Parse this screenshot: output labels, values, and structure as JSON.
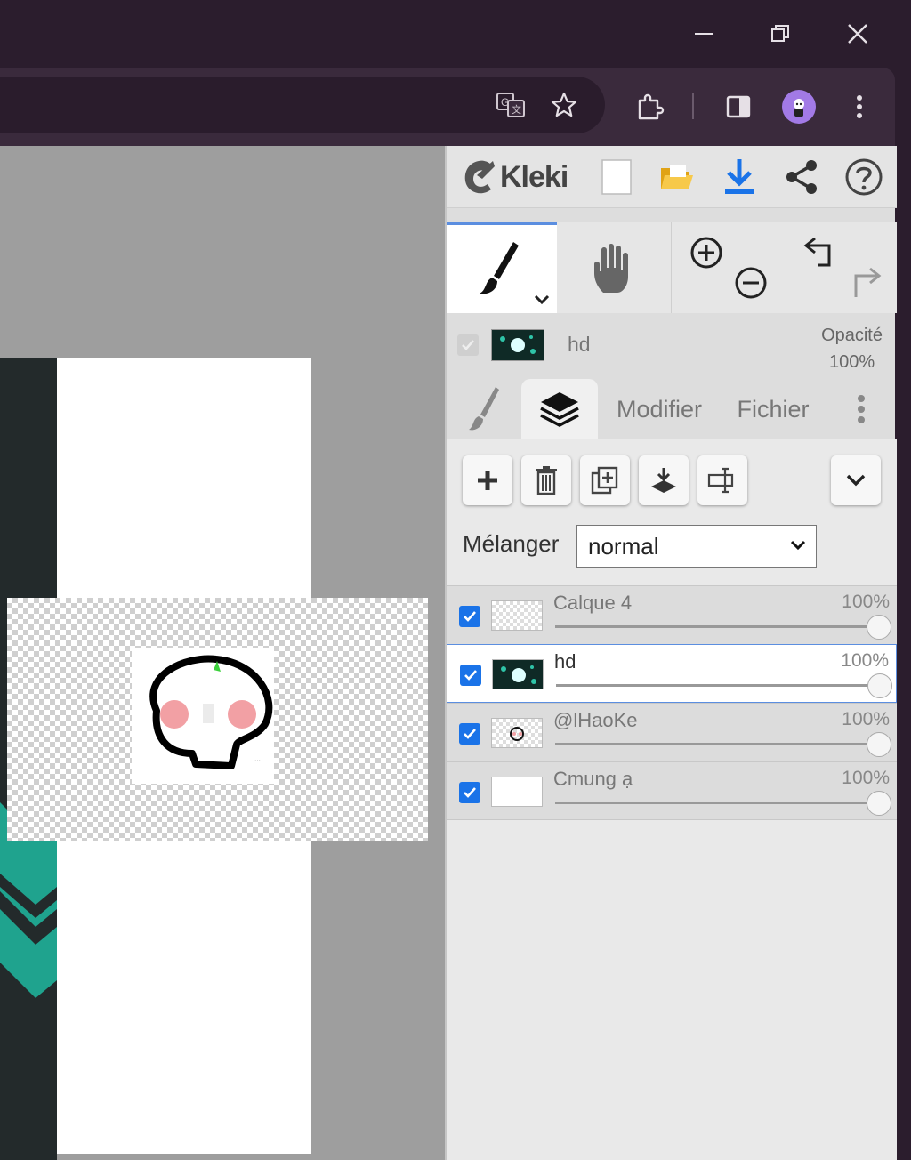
{
  "app": {
    "name": "Kleki"
  },
  "layer_info": {
    "current_name": "hd",
    "opacity_label": "Opacité",
    "opacity_value": "100%"
  },
  "tabs": {
    "modifier": "Modifier",
    "fichier": "Fichier"
  },
  "blend": {
    "label": "Mélanger",
    "value": "normal"
  },
  "layers": [
    {
      "name": "Calque 4",
      "opacity": "100%",
      "selected": false
    },
    {
      "name": "hd",
      "opacity": "100%",
      "selected": true
    },
    {
      "name": "@lHaoKe",
      "opacity": "100%",
      "selected": false
    },
    {
      "name": "Cmung ạ",
      "opacity": "100%",
      "selected": false
    }
  ],
  "colors": {
    "accent": "#1a73e8",
    "download": "#1a73e8",
    "folder": "#f2b51f",
    "avatar": "#a27ae6",
    "teal": "#1fa38e"
  },
  "icons": [
    "minimize-icon",
    "restore-icon",
    "close-icon",
    "translate-icon",
    "star-icon",
    "extensions-icon",
    "sidepanel-icon",
    "menu-icon",
    "new-image-icon",
    "open-folder-icon",
    "download-icon",
    "share-icon",
    "help-icon",
    "brush-icon",
    "hand-icon",
    "zoom-in-icon",
    "zoom-out-icon",
    "undo-icon",
    "redo-icon",
    "layers-icon",
    "add-layer-icon",
    "delete-layer-icon",
    "duplicate-layer-icon",
    "merge-down-icon",
    "rename-layer-icon"
  ]
}
